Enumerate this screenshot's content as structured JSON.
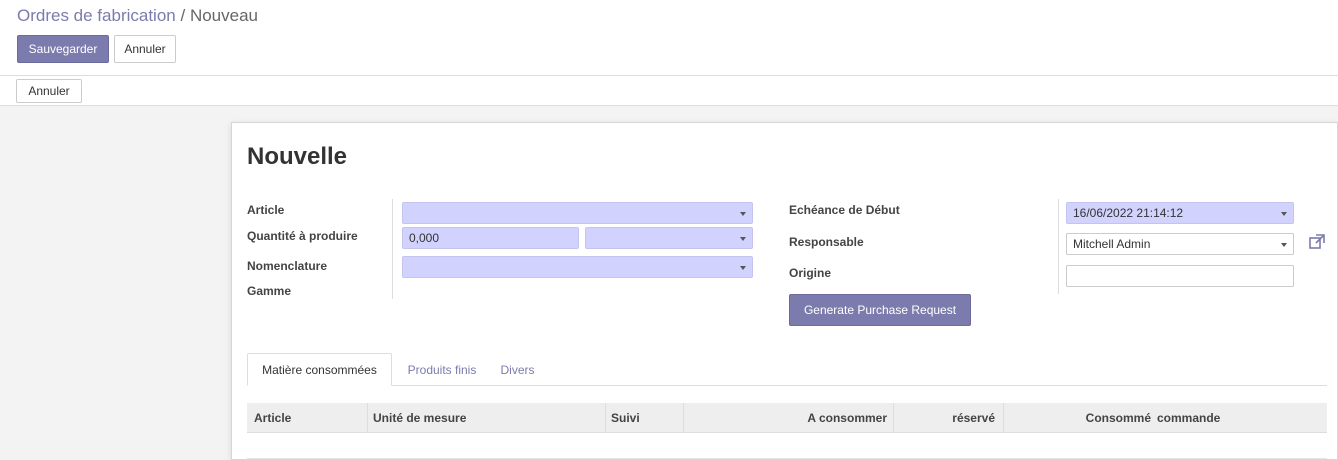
{
  "breadcrumb": {
    "parent": "Ordres de fabrication",
    "separator": "/",
    "current": "Nouveau"
  },
  "control_panel": {
    "save_label": "Sauvegarder",
    "discard_label": "Annuler"
  },
  "statusbar": {
    "cancel_label": "Annuler"
  },
  "form": {
    "title": "Nouvelle",
    "left_fields": {
      "article_label": "Article",
      "quantity_label": "Quantité à produire",
      "quantity_value": "0,000",
      "bom_label": "Nomenclature",
      "routing_label": "Gamme"
    },
    "right_fields": {
      "start_date_label": "Echéance de Début",
      "start_date_value": "16/06/2022 21:14:12",
      "responsible_label": "Responsable",
      "responsible_value": "Mitchell Admin",
      "origin_label": "Origine",
      "origin_value": ""
    },
    "generate_button_label": "Generate Purchase Request"
  },
  "tabs": [
    {
      "label": "Matière consommées",
      "active": true
    },
    {
      "label": "Produits finis",
      "active": false
    },
    {
      "label": "Divers",
      "active": false
    }
  ],
  "table": {
    "columns": [
      "Article",
      "Unité de mesure",
      "Suivi",
      "A consommer",
      "réservé",
      "Consommé",
      "commande"
    ]
  },
  "colors": {
    "primary": "#7c7bad",
    "required_field": "#d2d2ff",
    "link": "#7c7bad"
  },
  "icons": {
    "external_link": "external-link-icon",
    "dropdown": "chevron-down-icon"
  }
}
